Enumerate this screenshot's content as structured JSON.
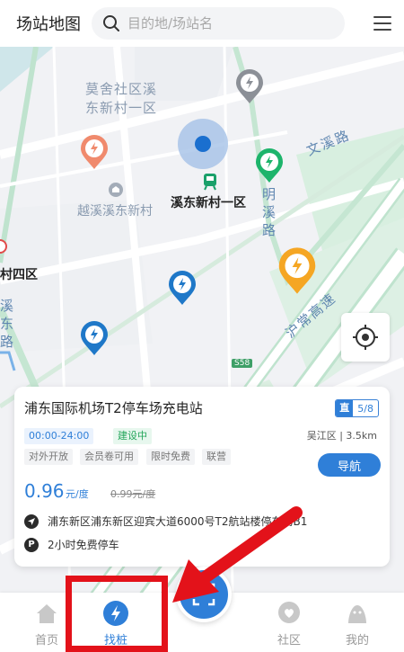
{
  "header": {
    "title": "场站地图",
    "search_placeholder": "目的地/场站名"
  },
  "map": {
    "labels": {
      "moshe_line1": "莫舍社区溪",
      "moshe_line2": "东新村一区",
      "yuexi": "越溪溪东新村",
      "xidong_station": "溪东新村一区",
      "cun4": "村四区",
      "xi_vertical": "溪东路",
      "wenxi_road": "文溪路",
      "mingxi_road": "明溪路",
      "huchang": "沪常高速",
      "s58": "S58"
    }
  },
  "station": {
    "name": "浦东国际机场T2停车场充电站",
    "badge_type": "直",
    "badge_count": "5/8",
    "hours": "00:00-24:00",
    "status": "建设中",
    "district": "吴江区 | 3.5km",
    "tags": [
      "对外开放",
      "会员卷可用",
      "限时免费",
      "联营"
    ],
    "navigate_label": "导航",
    "price": "0.96",
    "price_unit": "元/度",
    "price_original": "0.99元/度",
    "address": "浦东新区浦东新区迎宾大道6000号T2航站楼停车场B1",
    "parking": "2小时免费停车",
    "parking_icon": "P"
  },
  "tabbar": {
    "home": "首页",
    "find": "找桩",
    "community": "社区",
    "mine": "我的"
  },
  "colors": {
    "accent": "#2f7fd8",
    "status_green": "#23a55a",
    "annotation_red": "#e3121a"
  }
}
